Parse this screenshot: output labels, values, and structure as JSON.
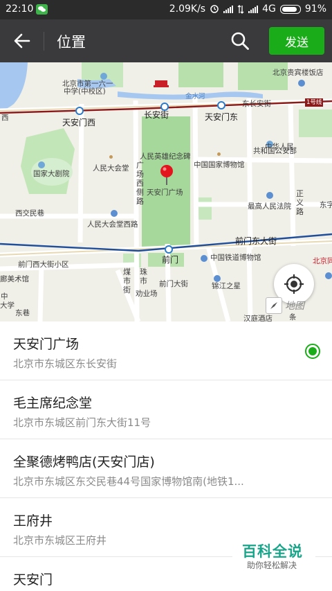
{
  "status_bar": {
    "time": "22:10",
    "speed": "2.09K/s",
    "network": "4G",
    "battery": "91%"
  },
  "title_bar": {
    "title": "位置",
    "send_label": "发送",
    "back_icon": "back-arrow-icon",
    "search_icon": "search-icon"
  },
  "map": {
    "labels": {
      "guibin": "北京贵宾楼饭店",
      "no61_a": "北京市第一六一",
      "no61_b": "中学(中校区)",
      "jinshuihe": "金水河",
      "tiananmenxi": "天安门西",
      "changanjie": "长安街",
      "tiananmendong": "天安门东",
      "dongchanganjie": "东长安街",
      "line1": "1号线",
      "xi": "西",
      "monument": "人民英雄纪念碑",
      "gongan_a": "中华人民",
      "gongan_b": "共和国公安部",
      "national_theatre": "国家大剧院",
      "dahuitang": "人民大会堂",
      "guangchangxi": "广场西侧路",
      "museum": "中国国家博物馆",
      "square": "天安门广场",
      "zhengyilu": "正义路",
      "court": "最高人民法院",
      "xijiaominxiang": "西交民巷",
      "dahuitang_west": "人民大会堂西路",
      "dong": "东字",
      "qianmendongdajie": "前门东大街",
      "qianmen": "前门",
      "railway_museum": "中国铁道博物馆",
      "beijingzhan": "北京同",
      "qianmenxidajie": "前门西大街小区",
      "art_museum": "廊美术馆",
      "qianmendajie": "前门大街",
      "jinjiang": "锦江之星",
      "meishijie": "煤市街",
      "zhuhangshi": "珠市",
      "dongxiang": "东巷",
      "xuekeli": "劝业场",
      "university": "大学",
      "hanting": "汉庭酒店",
      "tiao": "条",
      "cn": "中"
    },
    "logo_text": "地图",
    "locate_icon": "locate-target-icon",
    "compass_icon": "compass-icon",
    "pin_icon": "location-pin-icon"
  },
  "results": [
    {
      "name": "天安门广场",
      "address": "北京市东城区东长安街",
      "selected": true
    },
    {
      "name": "毛主席纪念堂",
      "address": "北京市东城区前门东大街11号",
      "selected": false
    },
    {
      "name": "全聚德烤鸭店(天安门店)",
      "address": "北京市东城区东交民巷44号国家博物馆南(地铁1...",
      "selected": false
    },
    {
      "name": "王府井",
      "address": "北京市东城区王府井",
      "selected": false
    },
    {
      "name": "天安门",
      "address": "",
      "selected": false
    }
  ],
  "watermark": {
    "main": "百科全说",
    "sub": "助你轻松解决"
  }
}
